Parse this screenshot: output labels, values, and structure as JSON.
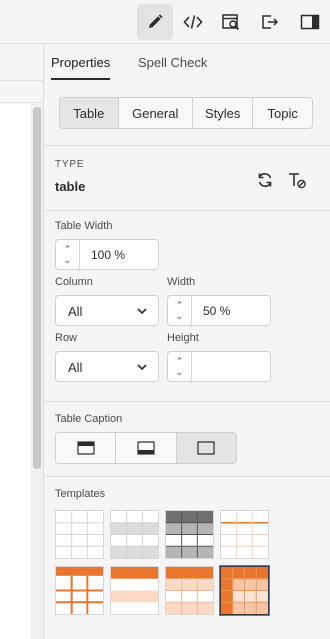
{
  "toolbar": {
    "buttons": [
      {
        "icon": "pencil-icon",
        "active": true
      },
      {
        "icon": "code-icon",
        "active": false
      },
      {
        "icon": "preview-search-icon",
        "active": false
      },
      {
        "icon": "export-icon",
        "active": false
      },
      {
        "icon": "panel-toggle-icon",
        "active": false
      }
    ]
  },
  "panel": {
    "tabs": [
      {
        "label": "Properties",
        "active": true
      },
      {
        "label": "Spell Check",
        "active": false
      }
    ],
    "segments": [
      {
        "label": "Table",
        "active": true
      },
      {
        "label": "General",
        "active": false
      },
      {
        "label": "Styles",
        "active": false
      },
      {
        "label": "Topic",
        "active": false
      }
    ],
    "type_label": "TYPE",
    "type_value": "table",
    "table_width_label": "Table Width",
    "table_width_value": "100 %",
    "column_label": "Column",
    "column_value": "All",
    "width_label": "Width",
    "width_value": "50 %",
    "row_label": "Row",
    "row_value": "All",
    "height_label": "Height",
    "height_value": "",
    "caption_label": "Table Caption",
    "caption_options": [
      "caption-top",
      "caption-bottom",
      "no-caption"
    ],
    "caption_selected": 2,
    "templates_label": "Templates",
    "templates": [
      "plain-grid",
      "header-gray",
      "banded-gray",
      "orange-lines",
      "orange-header-lines",
      "orange-banded",
      "orange-header-bands",
      "orange-full-selected"
    ],
    "selected_template": 7,
    "accent_color": "#e8762d"
  }
}
